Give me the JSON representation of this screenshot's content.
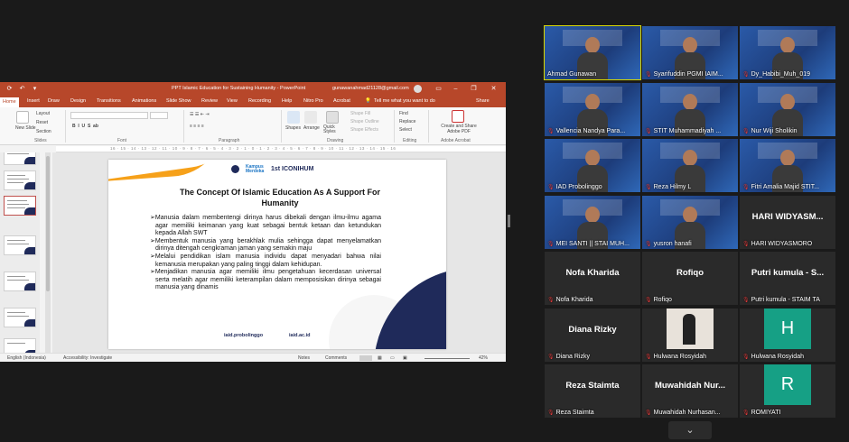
{
  "ppt": {
    "doc_title": "PPT Islamic Education for Sustaining Humanity  -  PowerPoint",
    "account": "gunawanahmad21128@gmail.com",
    "tabs": [
      "Home",
      "Insert",
      "Draw",
      "Design",
      "Transitions",
      "Animations",
      "Slide Show",
      "Review",
      "View",
      "Recording",
      "Help",
      "Nitro Pro",
      "Acrobat"
    ],
    "tell_me": "Tell me what you want to do",
    "share": "Share",
    "ribbon": {
      "new_slide": "New Slide",
      "layout": "Layout",
      "reset": "Reset",
      "section": "Section",
      "slides_group": "Slides",
      "font_group": "Font",
      "paragraph_group": "Paragraph",
      "drawing_group": "Drawing",
      "editing_group": "Editing",
      "adobe_group": "Adobe Acrobat",
      "shapes": "Shapes",
      "arrange": "Arrange",
      "quick_styles": "Quick Styles",
      "shape_fill": "Shape Fill",
      "shape_outline": "Shape Outline",
      "shape_effects": "Shape Effects",
      "find": "Find",
      "replace": "Replace",
      "select": "Select",
      "adobe_btn": "Create and Share Adobe PDF"
    },
    "ruler": "16 · 15 · 14 · 13 · 12 · 11 · 10 · 9 · 8 · 7 · 6 · 5 · 4 · 3 · 2 · 1 · 0 · 1 · 2 · 3 · 4 · 5 · 6 · 7 · 8 · 9 · 10 · 11 · 12 · 13 · 14 · 15 · 16",
    "thumb_numbers": [
      "",
      "",
      "",
      "",
      "",
      ""
    ],
    "slide": {
      "title": "The Concept Of Islamic Education As A Support For Humanity",
      "bullets": [
        "➢Manusia dalam membentengi dirinya harus dibekali dengan ilmu-ilmu agama agar memiliki keimanan yang kuat sebagai bentuk ketaan dan ketundukan kepada Allah SWT",
        "➢Membentuk manusia yang berakhlak mulia sehingga dapat menyelamatkan dirinya ditengah cengkraman jaman yang semakin maju",
        "➢Melalui pendidikan islam manusia individu dapat menyadari bahwa nilai kemanusia merupakan yang paling tinggi dalam kehidupan.",
        "➢Menjadikan manusia agar memiliki ilmu pengetahuan kecerdasan universal serta melatih agar memiliki keterampilan dalam memposisikan dirinya sebagai manusia yang dinamis"
      ],
      "logo_top": "1st ICONIHUM",
      "logo_kampus": "Kampus Merdeka",
      "logo_bottom_left": "iaid.probolinggo",
      "logo_bottom_right": "iaid.ac.id"
    },
    "status": {
      "language": "English (Indonesia)",
      "accessibility": "Accessibility: Investigate",
      "notes": "Notes",
      "comments": "Comments",
      "zoom": "42%"
    }
  },
  "participants": [
    {
      "name": "Ahmad Gunawan",
      "type": "video",
      "active": true,
      "muted": false
    },
    {
      "name": "Syarifuddin PGMI IAIM...",
      "type": "video",
      "muted": true
    },
    {
      "name": "Dy_Habibi_Muh_019",
      "type": "video",
      "muted": true
    },
    {
      "name": "Vallencia Nandya Para...",
      "type": "video",
      "muted": true
    },
    {
      "name": "STIT Muhammadiyah ...",
      "type": "video",
      "muted": true
    },
    {
      "name": "Nur Wiji Sholikin",
      "type": "video",
      "muted": true
    },
    {
      "name": "IAD Probolinggo",
      "type": "video",
      "muted": true
    },
    {
      "name": "Reza Hilmy L",
      "type": "video",
      "muted": true
    },
    {
      "name": "Fitri Amalia Majid STIT...",
      "type": "video",
      "muted": true
    },
    {
      "name": "MEI SANTI || STAI MUH...",
      "type": "video",
      "muted": true
    },
    {
      "name": "yusron hanafi",
      "type": "video",
      "muted": true
    },
    {
      "name": "HARI WIDYASMORO",
      "big": "HARI WIDYASM...",
      "type": "text",
      "muted": true
    },
    {
      "name": "Nofa Kharida",
      "big": "Nofa Kharida",
      "type": "text",
      "muted": true
    },
    {
      "name": "Rofiqo",
      "big": "Rofiqo",
      "type": "text",
      "muted": true
    },
    {
      "name": "Putri kumula - STAIM TA",
      "big": "Putri kumula - S...",
      "type": "text",
      "muted": true
    },
    {
      "name": "Diana Rizky",
      "big": "Diana Rizky",
      "type": "text",
      "muted": true
    },
    {
      "name": "Hulwana Rosyidah",
      "type": "photo",
      "muted": true
    },
    {
      "name": "Hulwana Rosyidah",
      "letter": "H",
      "type": "letter",
      "muted": true
    },
    {
      "name": "Reza Staimta",
      "big": "Reza Staimta",
      "type": "text",
      "muted": true
    },
    {
      "name": "Muwahidah Nurhasan...",
      "big": "Muwahidah Nur...",
      "type": "text",
      "muted": true
    },
    {
      "name": "ROMIYATI",
      "letter": "R",
      "type": "letter",
      "muted": true
    }
  ],
  "icons": {
    "mic_muted": "mic-muted-icon",
    "chevron": "chevron-down-icon"
  }
}
